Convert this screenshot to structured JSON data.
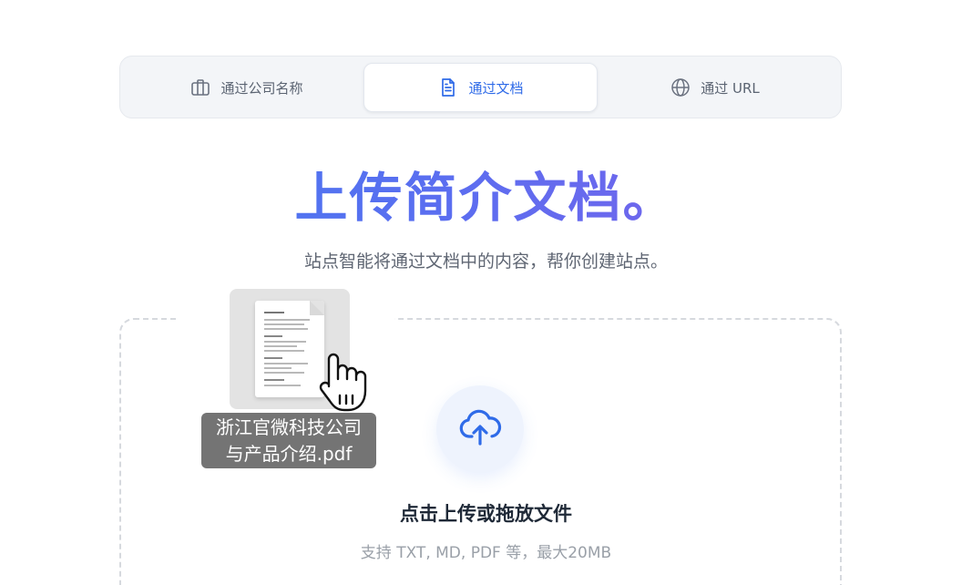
{
  "tabs": [
    {
      "label": "通过公司名称",
      "icon": "briefcase-icon",
      "active": false
    },
    {
      "label": "通过文档",
      "icon": "document-icon",
      "active": true
    },
    {
      "label": "通过 URL",
      "icon": "globe-icon",
      "active": false
    }
  ],
  "heading": "上传简介文档。",
  "subtitle": "站点智能将通过文档中的内容，帮你创建站点。",
  "upload": {
    "title": "点击上传或拖放文件",
    "hint": "支持 TXT, MD, PDF 等，最大20MB",
    "icon": "cloud-upload-icon"
  },
  "dragged_file": {
    "name_line1": "浙江官微科技公司",
    "name_line2": "与产品介绍.pdf",
    "icon": "pointer-hand-icon"
  },
  "colors": {
    "accent": "#2f6be8",
    "heading_gradient_start": "#3f7df0",
    "heading_gradient_end": "#8b5ee8"
  }
}
